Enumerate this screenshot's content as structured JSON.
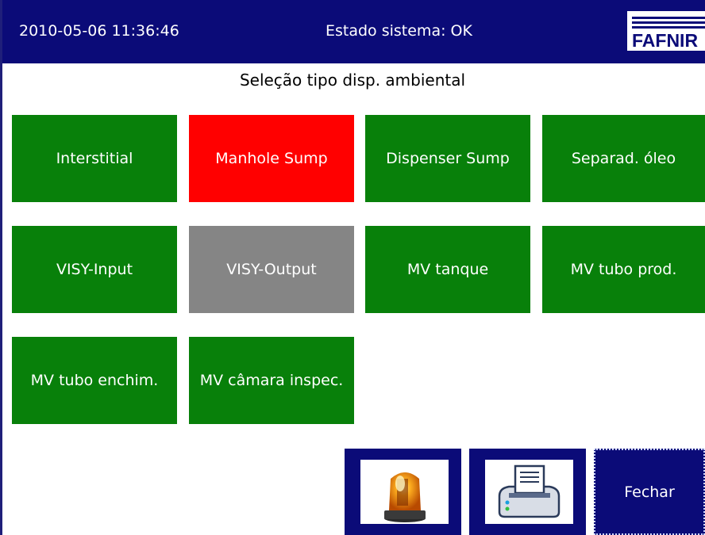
{
  "header": {
    "datetime": "2010-05-06  11:36:46",
    "status": "Estado sistema: OK",
    "logo_text": "FAFNIR"
  },
  "page_title": "Seleção tipo disp. ambiental",
  "tiles": [
    {
      "label": "Interstitial",
      "state": "ok",
      "color": "#08800a"
    },
    {
      "label": "Manhole Sump",
      "state": "alarm",
      "color": "#ff0000"
    },
    {
      "label": "Dispenser Sump",
      "state": "ok",
      "color": "#08800a"
    },
    {
      "label": "Separad. óleo",
      "state": "ok",
      "color": "#08800a"
    },
    {
      "label": "VISY-Input",
      "state": "ok",
      "color": "#08800a"
    },
    {
      "label": "VISY-Output",
      "state": "inactive",
      "color": "#858585"
    },
    {
      "label": "MV tanque",
      "state": "ok",
      "color": "#08800a"
    },
    {
      "label": "MV tubo prod.",
      "state": "ok",
      "color": "#08800a"
    },
    {
      "label": "MV tubo enchim.",
      "state": "ok",
      "color": "#08800a"
    },
    {
      "label": "MV câmara inspec.",
      "state": "ok",
      "color": "#08800a"
    }
  ],
  "footer": {
    "alarm_icon": "alarm-beacon-icon",
    "print_icon": "printer-icon",
    "close_label": "Fechar"
  },
  "colors": {
    "header_bg": "#0b0b78",
    "ok": "#08800a",
    "alarm": "#ff0000",
    "inactive": "#858585"
  }
}
